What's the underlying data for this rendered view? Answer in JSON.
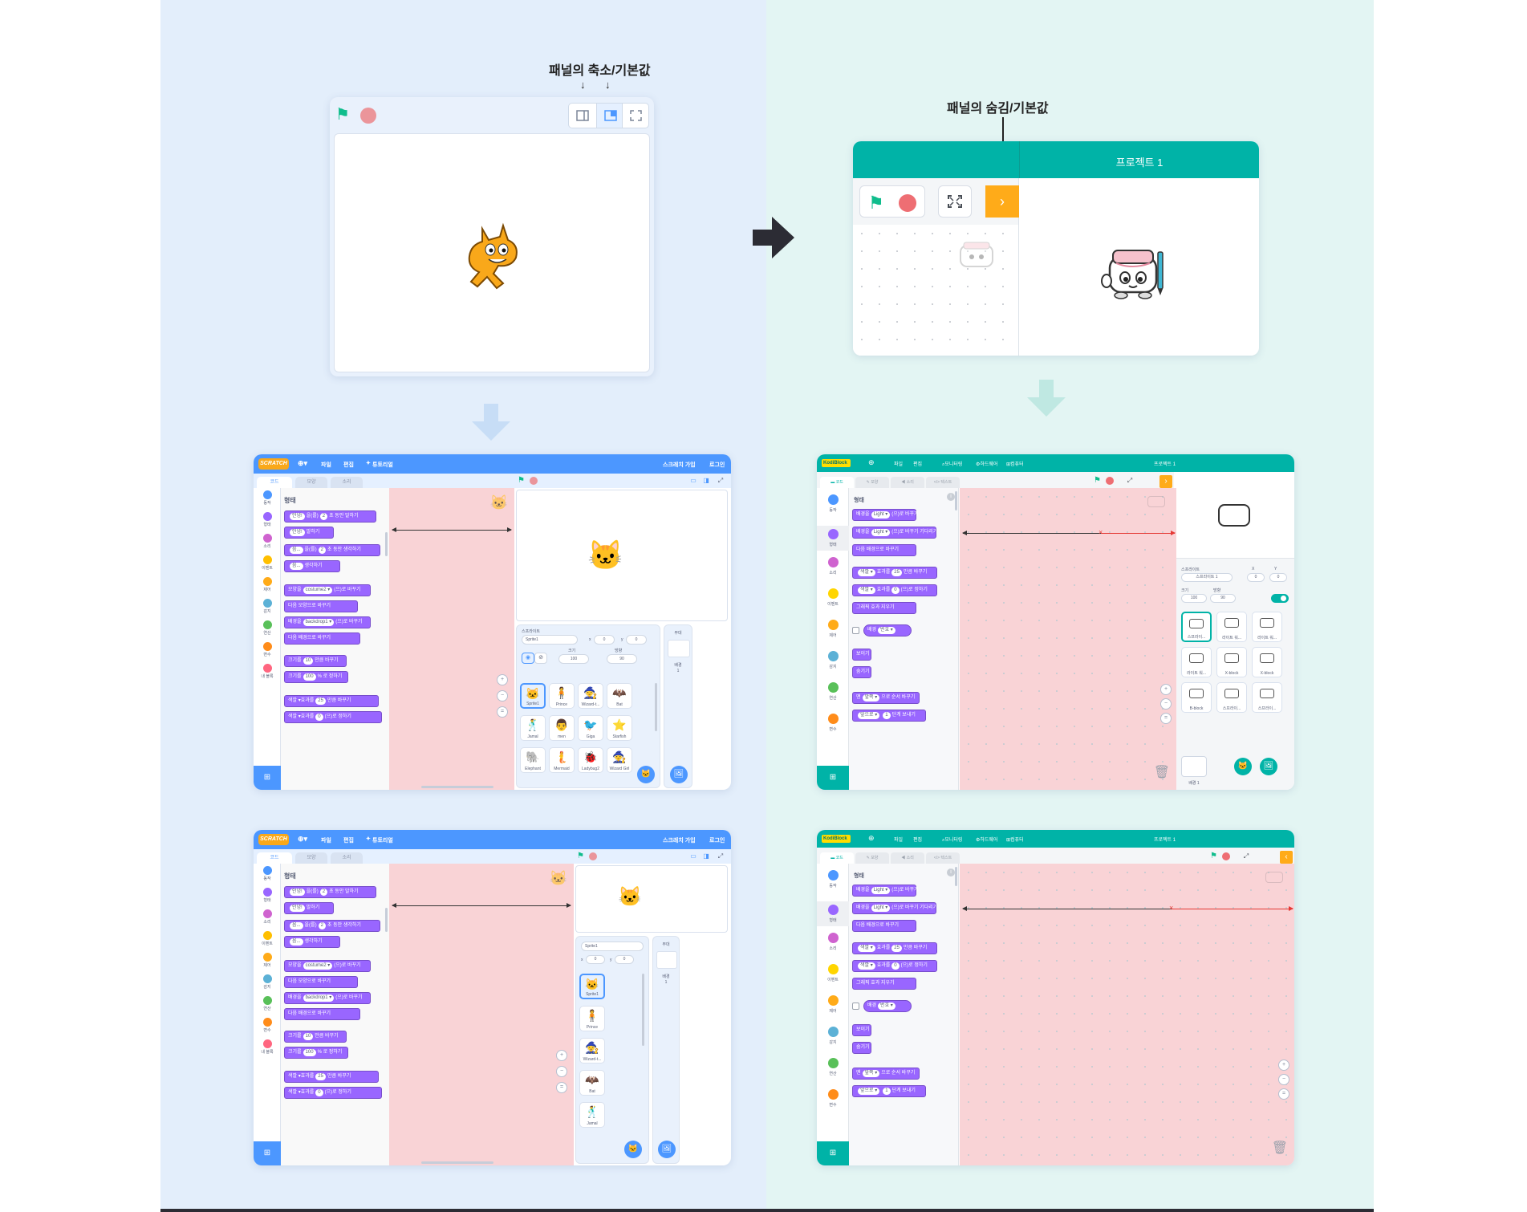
{
  "annotations": {
    "left_title": "패널의 축소/기본값",
    "right_title": "패널의 숨김/기본값"
  },
  "scratch": {
    "logo": "SCRATCH",
    "menu": [
      "파일",
      "편집",
      "튜토리얼"
    ],
    "menu_right": [
      "스크래치 가입",
      "로그인"
    ],
    "tabs": [
      "코드",
      "모양",
      "소리"
    ],
    "categories": [
      {
        "label": "동작",
        "color": "#4c97ff"
      },
      {
        "label": "형태",
        "color": "#9966ff"
      },
      {
        "label": "소리",
        "color": "#cf63cf"
      },
      {
        "label": "이벤트",
        "color": "#ffbf00"
      },
      {
        "label": "제어",
        "color": "#ffab19"
      },
      {
        "label": "감지",
        "color": "#5cb1d6"
      },
      {
        "label": "연산",
        "color": "#59c059"
      },
      {
        "label": "변수",
        "color": "#ff8c1a"
      },
      {
        "label": "내 블록",
        "color": "#ff6680"
      }
    ],
    "palette_title": "형태",
    "blocks": [
      {
        "pre": "",
        "arg": "안녕!",
        "mid": "을(를)",
        "arg2": "2",
        "post": "초 동안 말하기"
      },
      {
        "pre": "",
        "arg": "안녕!",
        "mid": "말하기",
        "arg2": "",
        "post": ""
      },
      {
        "pre": "",
        "arg": "음...",
        "mid": "을(를)",
        "arg2": "2",
        "post": "초 동안 생각하기"
      },
      {
        "pre": "",
        "arg": "음...",
        "mid": "생각하기",
        "arg2": "",
        "post": ""
      },
      {
        "pre": "모양을",
        "arg": "costume2 ▾",
        "mid": "(으)로 바꾸기",
        "arg2": "",
        "post": ""
      },
      {
        "pre": "다음 모양으로 바꾸기",
        "arg": "",
        "mid": "",
        "arg2": "",
        "post": ""
      },
      {
        "pre": "배경을",
        "arg": "backdrop1 ▾",
        "mid": "(으)로 바꾸기",
        "arg2": "",
        "post": ""
      },
      {
        "pre": "다음 배경으로 바꾸기",
        "arg": "",
        "mid": "",
        "arg2": "",
        "post": ""
      },
      {
        "pre": "크기를",
        "arg": "10",
        "mid": "만큼 바꾸기",
        "arg2": "",
        "post": ""
      },
      {
        "pre": "크기를",
        "arg": "100",
        "mid": "% 로 정하기",
        "arg2": "",
        "post": ""
      },
      {
        "pre": "색깔 ▾",
        "arg": "",
        "mid": "효과를",
        "arg2": "25",
        "post": "만큼 바꾸기"
      },
      {
        "pre": "색깔 ▾",
        "arg": "",
        "mid": "효과를",
        "arg2": "0",
        "post": "(으)로 정하기"
      }
    ],
    "sprite_info": {
      "label": "스프라이트",
      "name": "Sprite1",
      "x_label": "x",
      "x": "0",
      "y_label": "y",
      "y": "0",
      "size_label": "크기",
      "size": "100",
      "direction_label": "방향",
      "direction": "90"
    },
    "stage_label": "무대",
    "backdrop_label": "배경",
    "backdrop_count": "1",
    "sprites": [
      "Sprite1",
      "Prince",
      "Wizard-t...",
      "Bat",
      "Jamal",
      "men",
      "Giga",
      "Starfish",
      "Elephant",
      "Mermaid",
      "Ladybug2",
      "Wizard Girl"
    ],
    "sprites_narrow": [
      "Sprite1",
      "Prince",
      "Wizard-t...",
      "Bat",
      "Jamal"
    ]
  },
  "kodi": {
    "logo": "KodiBlock",
    "menu": [
      "파일",
      "편집",
      "모니터링",
      "하드웨어",
      "컴퓨터"
    ],
    "project_title": "프로젝트 1",
    "tabs": [
      "코드",
      "모양",
      "소리",
      "텍스트"
    ],
    "categories": [
      {
        "label": "동작",
        "color": "#4c97ff"
      },
      {
        "label": "형태",
        "color": "#9966ff"
      },
      {
        "label": "소리",
        "color": "#cf63cf"
      },
      {
        "label": "이벤트",
        "color": "#ffd500"
      },
      {
        "label": "제어",
        "color": "#ffab19"
      },
      {
        "label": "감지",
        "color": "#5cb1d6"
      },
      {
        "label": "연산",
        "color": "#59c059"
      },
      {
        "label": "변수",
        "color": "#ff8c1a"
      }
    ],
    "palette_title": "형태",
    "blocks": [
      {
        "pre": "배경을",
        "arg": "Light ▾",
        "post": "(으)로 바꾸기"
      },
      {
        "pre": "배경을",
        "arg": "Light ▾",
        "post": "(으)로 바꾸기 기다리기"
      },
      {
        "pre": "다음 배경으로 바꾸기",
        "arg": "",
        "post": ""
      },
      {
        "pre": "",
        "arg": "색깔 ▾",
        "post": "효과를",
        "arg2": "25",
        "post2": "만큼 바꾸기"
      },
      {
        "pre": "",
        "arg": "색깔 ▾",
        "post": "효과를",
        "arg2": "0",
        "post2": "(으)로 정하기"
      },
      {
        "pre": "그래픽 효과 지우기",
        "arg": "",
        "post": ""
      },
      {
        "pre": "배경",
        "arg": "번호 ▾",
        "post": ""
      },
      {
        "pre": "보이기",
        "arg": "",
        "post": ""
      },
      {
        "pre": "숨기기",
        "arg": "",
        "post": ""
      },
      {
        "pre": "맨",
        "arg": "앞쪽 ▾",
        "post": "으로 순서 바꾸기"
      },
      {
        "pre": "",
        "arg": "앞으로 ▾",
        "post": "",
        "arg2": "1",
        "post2": "단계 보내기"
      }
    ],
    "sprite_info": {
      "label": "스프라이트",
      "name": "스프라이트 1",
      "x_label": "X",
      "x": "0",
      "y_label": "Y",
      "y": "0",
      "size_label": "크기",
      "size": "100",
      "direction_label": "방향",
      "direction": "90"
    },
    "sprites": [
      "스프라이...",
      "라이트 워...",
      "라이트 워...",
      "라이트 워...",
      "X-block",
      "X-block",
      "B-block",
      "스프라이...",
      "스프라이..."
    ],
    "backdrop_label": "배경 1"
  }
}
